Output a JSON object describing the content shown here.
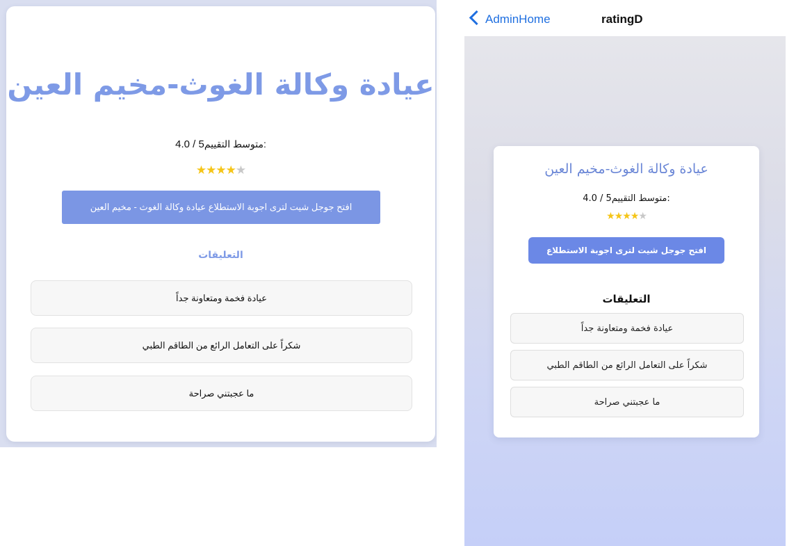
{
  "web": {
    "title": "عيادة وكالة الغوث-مخيم العين",
    "avg_label": "متوسط التقييم:",
    "avg_value": "4.0 / 5",
    "rating": 4,
    "max_rating": 5,
    "button_label": "افتح جوجل شيت لترى اجوبة الاستطلاع عيادة وكالة الغوث - مخيم العين",
    "comments_title": "التعليقات",
    "comments": [
      "عيادة فخمة ومتعاونة جداً",
      "شكراً على التعامل الرائع من الطاقم الطبي",
      "ما عجبتني صراحة"
    ],
    "colors": {
      "title": "#7e9ae6",
      "button": "#7b96e4",
      "star": "#f5c518"
    }
  },
  "phone": {
    "nav": {
      "back_label": "AdminHome",
      "title": "ratingD"
    },
    "title": "عيادة وكالة الغوث-مخيم العين",
    "avg_label": "متوسط التقييم:",
    "avg_value": "4.0 / 5",
    "rating": 4,
    "max_rating": 5,
    "button_label": "افتح جوجل شيت لترى اجوبة الاستطلاع",
    "comments_title": "التعليقات",
    "comments": [
      "عيادة فخمة ومتعاونة جداً",
      "شكراً على التعامل الرائع من الطاقم الطبي",
      "ما عجبتني صراحة"
    ],
    "colors": {
      "back": "#1f6fe0",
      "button": "#6b88e6"
    }
  }
}
